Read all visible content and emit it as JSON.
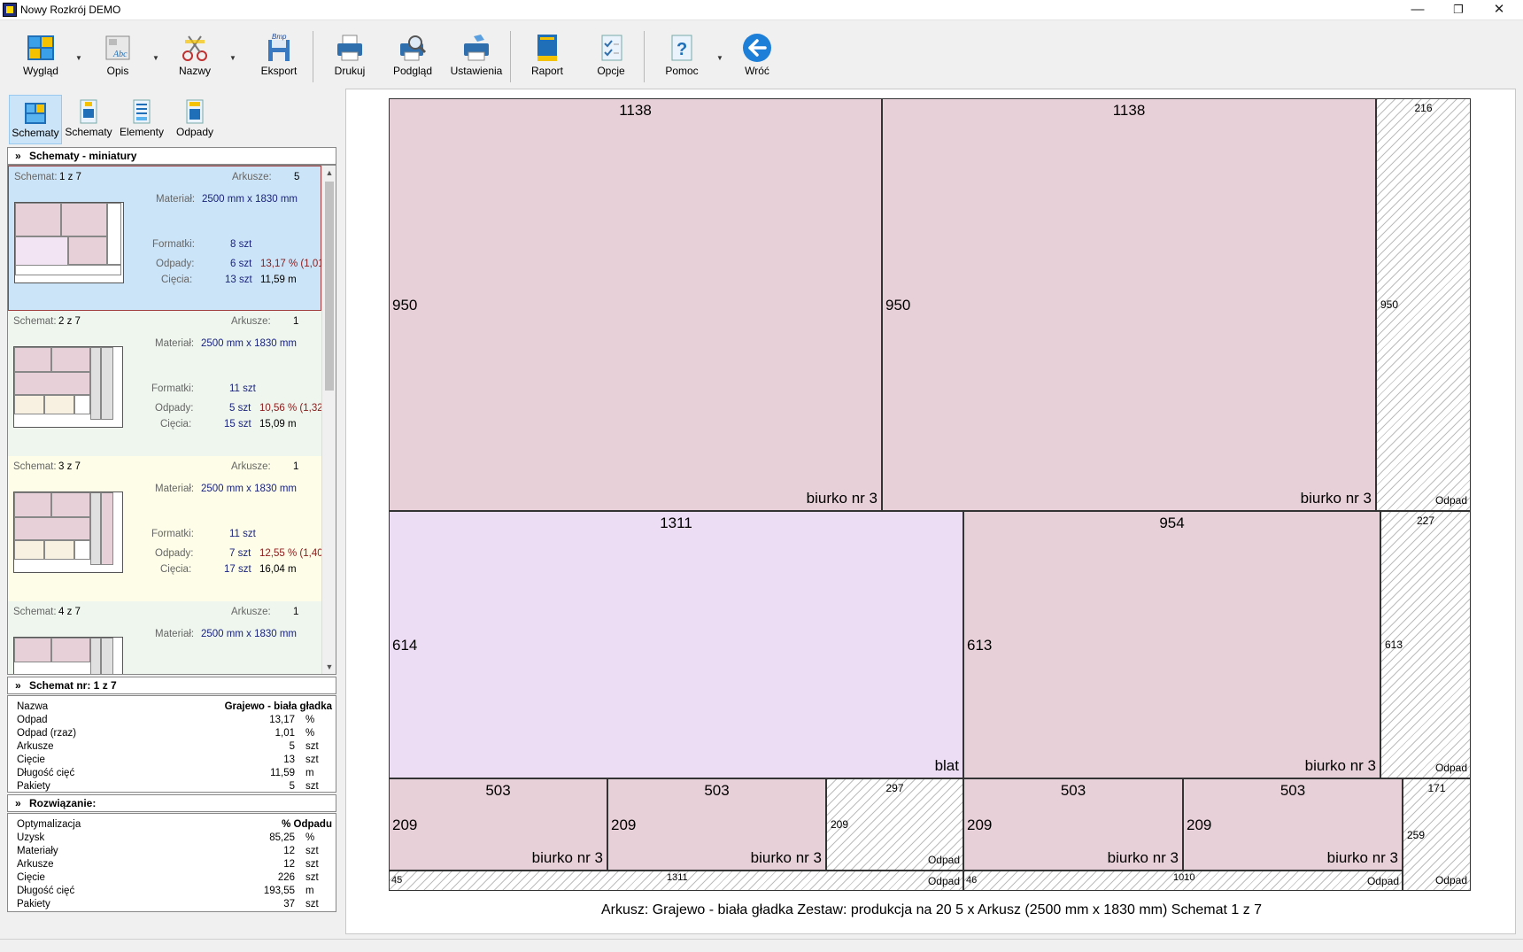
{
  "window": {
    "title": "Nowy Rozkrój DEMO",
    "minimize": "—",
    "restore": "❐",
    "close": "✕"
  },
  "toolbar": {
    "wyglad": "Wygląd",
    "opis": "Opis",
    "nazwy": "Nazwy",
    "eksport": "Eksport",
    "drukuj": "Drukuj",
    "podglad": "Podgląd",
    "ustawienia": "Ustawienia",
    "raport": "Raport",
    "opcje": "Opcje",
    "pomoc": "Pomoc",
    "wroc": "Wróć",
    "dropdown": "▼",
    "bmp": "Bmp",
    "abc": "Abc"
  },
  "viewtabs": [
    {
      "label": "Schematy"
    },
    {
      "label": "Schematy"
    },
    {
      "label": "Elementy"
    },
    {
      "label": "Odpady"
    }
  ],
  "thumbs_header": "Schematy - miniatury",
  "cards": [
    {
      "schemat_k": "Schemat:",
      "schemat": "1 z 7",
      "arkusze_k": "Arkusze:",
      "arkusze": "5",
      "material_k": "Materiał:",
      "material": "2500 mm x 1830 mm",
      "formatki_k": "Formatki:",
      "formatki": "8 szt",
      "odpady_k": "Odpady:",
      "odpady": "6 szt",
      "odpady_pct": "13,17 % (1,01",
      "ciecia_k": "Cięcia:",
      "ciecia": "13 szt",
      "ciecia_m": "11,59 m",
      "bg": "#cce4f7"
    },
    {
      "schemat_k": "Schemat:",
      "schemat": "2 z 7",
      "arkusze_k": "Arkusze:",
      "arkusze": "1",
      "material_k": "Materiał:",
      "material": "2500 mm x 1830 mm",
      "formatki_k": "Formatki:",
      "formatki": "11 szt",
      "odpady_k": "Odpady:",
      "odpady": "5 szt",
      "odpady_pct": "10,56 % (1,32",
      "ciecia_k": "Cięcia:",
      "ciecia": "15 szt",
      "ciecia_m": "15,09 m",
      "bg": "#eef6ee"
    },
    {
      "schemat_k": "Schemat:",
      "schemat": "3 z 7",
      "arkusze_k": "Arkusze:",
      "arkusze": "1",
      "material_k": "Materiał:",
      "material": "2500 mm x 1830 mm",
      "formatki_k": "Formatki:",
      "formatki": "11 szt",
      "odpady_k": "Odpady:",
      "odpady": "7 szt",
      "odpady_pct": "12,55 % (1,40",
      "ciecia_k": "Cięcia:",
      "ciecia": "17 szt",
      "ciecia_m": "16,04 m",
      "bg": "#fdfde8"
    },
    {
      "schemat_k": "Schemat:",
      "schemat": "4 z 7",
      "arkusze_k": "Arkusze:",
      "arkusze": "1",
      "material_k": "Materiał:",
      "material": "2500 mm x 1830 mm",
      "bg": "#eef6ee"
    }
  ],
  "schemat_header": "Schemat nr:  1 z 7",
  "schemat_props": [
    {
      "k": "Nazwa",
      "v": "Grajewo - biała gładka",
      "u": ""
    },
    {
      "k": "Odpad",
      "v": "13,17",
      "u": "%"
    },
    {
      "k": "Odpad (rzaz)",
      "v": "1,01",
      "u": "%"
    },
    {
      "k": "Arkusze",
      "v": "5",
      "u": "szt"
    },
    {
      "k": "Cięcie",
      "v": "13",
      "u": "szt"
    },
    {
      "k": "Długość cięć",
      "v": "11,59",
      "u": "m"
    },
    {
      "k": "Pakiety",
      "v": "5",
      "u": "szt"
    }
  ],
  "rozw_header": "Rozwiązanie:",
  "rozw_props": [
    {
      "k": "Optymalizacja",
      "v": "% Odpadu",
      "u": ""
    },
    {
      "k": "Uzysk",
      "v": "85,25",
      "u": "%"
    },
    {
      "k": "Materiały",
      "v": "12",
      "u": "szt"
    },
    {
      "k": "Arkusze",
      "v": "12",
      "u": "szt"
    },
    {
      "k": "Cięcie",
      "v": "226",
      "u": "szt"
    },
    {
      "k": "Długość cięć",
      "v": "193,55",
      "u": "m"
    },
    {
      "k": "Pakiety",
      "v": "37",
      "u": "szt"
    }
  ],
  "sheet": {
    "caption": "Arkusz: Grajewo - biała gładka  Zestaw: produkcja na 20  5 x Arkusz (2500 mm x 1830 mm)  Schemat 1 z 7",
    "pieces": [
      {
        "w": "1138",
        "h": "950",
        "name": "biurko nr 3"
      },
      {
        "w": "1138",
        "h": "950",
        "name": "biurko nr 3"
      },
      {
        "w": "216",
        "h": "950",
        "name": "Odpad"
      },
      {
        "w": "1311",
        "h": "614",
        "name": "blat"
      },
      {
        "w": "954",
        "h": "613",
        "name": "biurko nr 3"
      },
      {
        "w": "227",
        "h": "613",
        "name": "Odpad"
      },
      {
        "w": "503",
        "h": "209",
        "name": "biurko nr 3"
      },
      {
        "w": "503",
        "h": "209",
        "name": "biurko nr 3"
      },
      {
        "w": "297",
        "h": "209",
        "name": "Odpad"
      },
      {
        "w": "503",
        "h": "209",
        "name": "biurko nr 3"
      },
      {
        "w": "503",
        "h": "209",
        "name": "biurko nr 3"
      },
      {
        "w": "171",
        "h": "259",
        "name": "Odpad"
      },
      {
        "w": "1311",
        "h": "45",
        "name": "Odpad"
      },
      {
        "w": "1010",
        "h": "46",
        "name": "Odpad"
      }
    ]
  }
}
